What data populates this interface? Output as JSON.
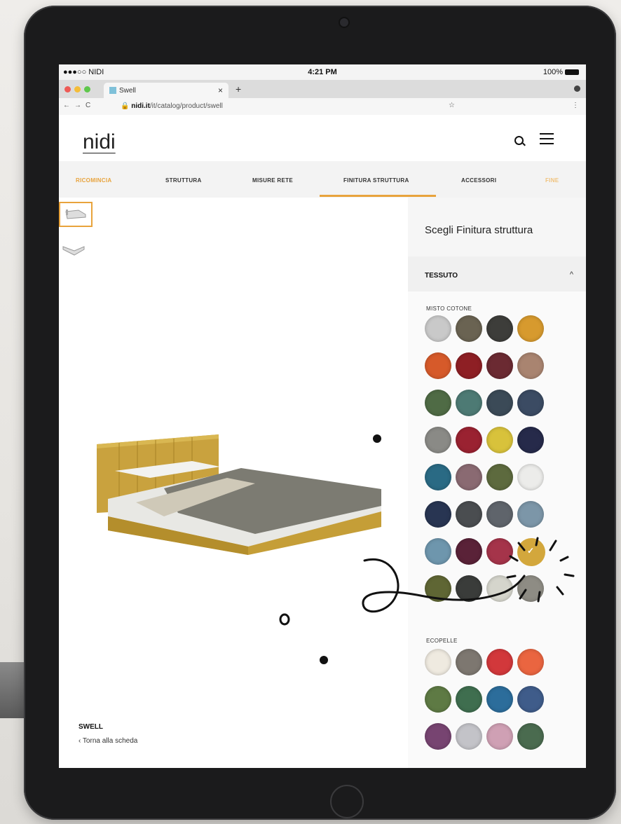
{
  "status_bar": {
    "carrier": "●●●○○ NIDI",
    "time": "4:21 PM",
    "battery": "100%"
  },
  "browser": {
    "tab_title": "Swell",
    "url_host": "nidi.it",
    "url_path": "/it/catalog/product/swell"
  },
  "site": {
    "logo": "nidi"
  },
  "steps": [
    {
      "label": "RICOMINCIA",
      "state": "done"
    },
    {
      "label": "STRUTTURA",
      "state": "normal"
    },
    {
      "label": "MISURE RETE",
      "state": "normal"
    },
    {
      "label": "FINITURA STRUTTURA",
      "state": "active"
    },
    {
      "label": "ACCESSORI",
      "state": "normal"
    },
    {
      "label": "FINE",
      "state": "light"
    }
  ],
  "product": {
    "name": "SWELL",
    "back_link": "‹ Torna alla scheda"
  },
  "panel": {
    "title": "Scegli Finitura struttura",
    "accordion_label": "TESSUTO",
    "section_1": "MISTO COTONE",
    "section_2": "ECOPELLE",
    "misto_cotone_colors": [
      "#c9c9c9",
      "#6a6352",
      "#3d3d3a",
      "#d79a2e",
      "#d65a2a",
      "#8e1f24",
      "#6b2a32",
      "#a98470",
      "#4f6b45",
      "#4d7a74",
      "#3b4a57",
      "#3b4b63",
      "#8a8a86",
      "#9a2231",
      "#d8c23b",
      "#262a4a",
      "#2a6a84",
      "#8a6a72",
      "#5d6a3e",
      "#ececea",
      "#283552",
      "#4a4d50",
      "#5f646b",
      "#7c96a8",
      "#6e96ad",
      "#5a2238",
      "#a5344a",
      "#d3a73c",
      "#5f6634",
      "#3a3c3a",
      "#d5d5cc",
      "#8e8c84"
    ],
    "selected_index": 27,
    "ecopelle_colors": [
      "#efeae0",
      "#7d7770",
      "#d2383b",
      "#ea6540",
      "#5e7a44",
      "#3f6e4f",
      "#2c6d9b",
      "#3f5c8a",
      "#774471",
      "#c3c3c8",
      "#cfa0b4",
      "#4a6b4f"
    ]
  }
}
